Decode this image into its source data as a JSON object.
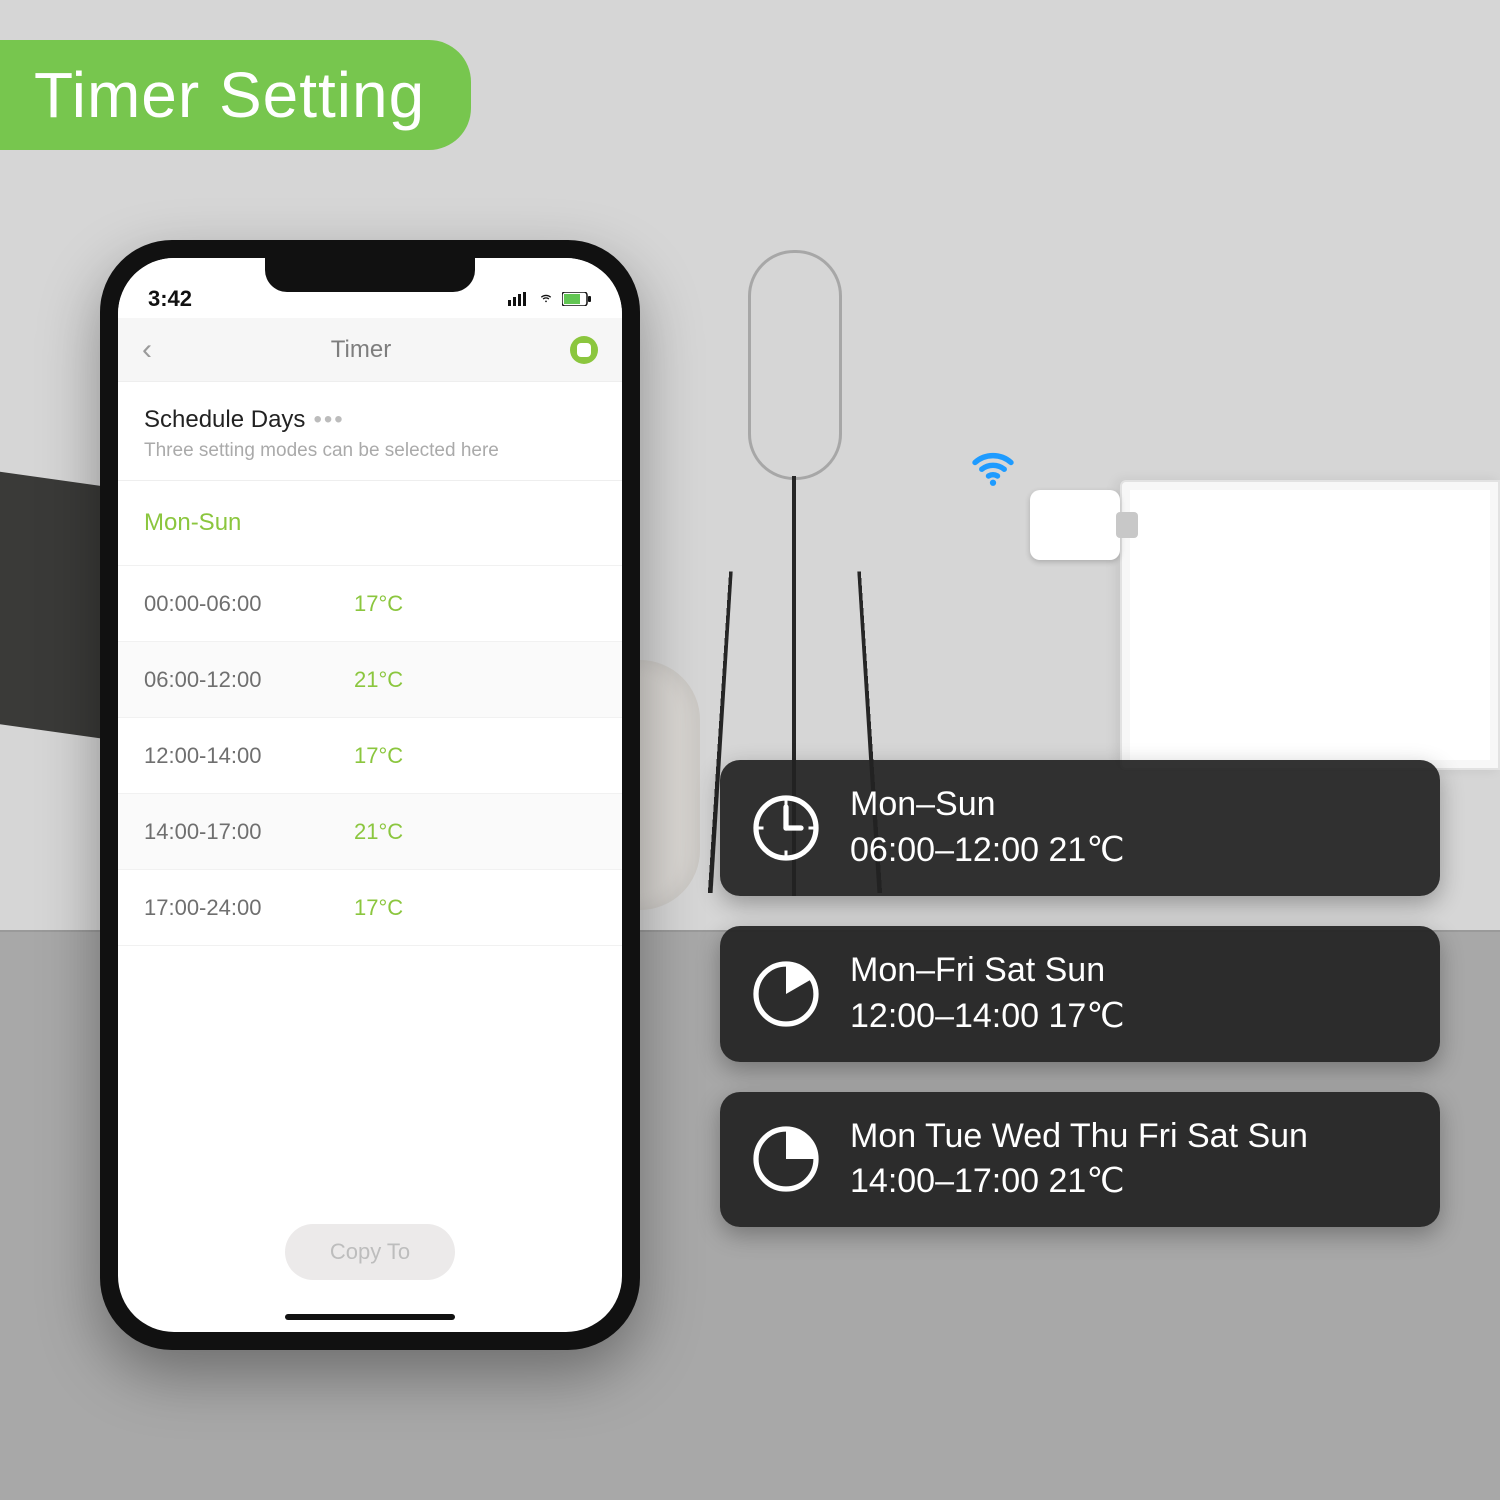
{
  "banner": {
    "title": "Timer Setting"
  },
  "phone": {
    "status": {
      "time": "3:42"
    },
    "nav": {
      "title": "Timer"
    },
    "section": {
      "title": "Schedule Days",
      "subtitle": "Three setting modes can be selected here"
    },
    "day_label": "Mon-Sun",
    "rows": [
      {
        "time": "00:00-06:00",
        "temp": "17°C"
      },
      {
        "time": "06:00-12:00",
        "temp": "21°C"
      },
      {
        "time": "12:00-14:00",
        "temp": "17°C"
      },
      {
        "time": "14:00-17:00",
        "temp": "21°C"
      },
      {
        "time": "17:00-24:00",
        "temp": "17°C"
      }
    ],
    "copy_label": "Copy To"
  },
  "callouts": [
    {
      "line1": "Mon–Sun",
      "line2": "06:00–12:00 21℃"
    },
    {
      "line1": "Mon–Fri Sat Sun",
      "line2": "12:00–14:00 17℃"
    },
    {
      "line1": "Mon Tue Wed Thu Fri Sat Sun",
      "line2": "14:00–17:00 21℃"
    }
  ]
}
